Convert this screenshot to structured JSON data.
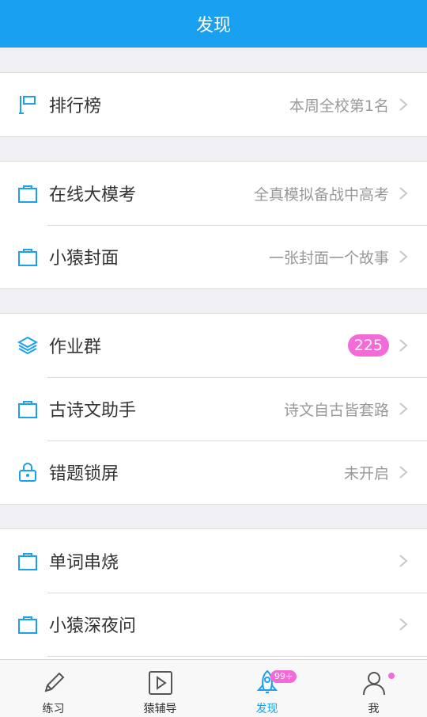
{
  "header": {
    "title": "发现"
  },
  "sections": [
    {
      "rows": [
        {
          "label": "排行榜",
          "value": "本周全校第1名",
          "icon": "flag-icon"
        }
      ]
    },
    {
      "rows": [
        {
          "label": "在线大模考",
          "value": "全真模拟备战中高考",
          "icon": "bag-icon"
        },
        {
          "label": "小猿封面",
          "value": "一张封面一个故事",
          "icon": "bag-icon"
        }
      ]
    },
    {
      "rows": [
        {
          "label": "作业群",
          "badge": "225",
          "icon": "layers-icon"
        },
        {
          "label": "古诗文助手",
          "value": "诗文自古皆套路",
          "icon": "bag-icon"
        },
        {
          "label": "错题锁屏",
          "value": "未开启",
          "icon": "lock-icon"
        }
      ]
    },
    {
      "rows": [
        {
          "label": "单词串烧",
          "value": "",
          "icon": "bag-icon"
        },
        {
          "label": "小猿深夜问",
          "value": "",
          "icon": "bag-icon"
        }
      ]
    }
  ],
  "tabbar": {
    "tabs": [
      {
        "label": "练习",
        "icon": "pencil-icon",
        "active": false
      },
      {
        "label": "猿辅导",
        "icon": "play-icon",
        "active": false
      },
      {
        "label": "发现",
        "icon": "rocket-icon",
        "active": true,
        "badge": "99+"
      },
      {
        "label": "我",
        "icon": "person-icon",
        "active": false,
        "dot": true
      }
    ]
  },
  "colors": {
    "accent": "#1aa0f0",
    "badge": "#f26bd6"
  }
}
